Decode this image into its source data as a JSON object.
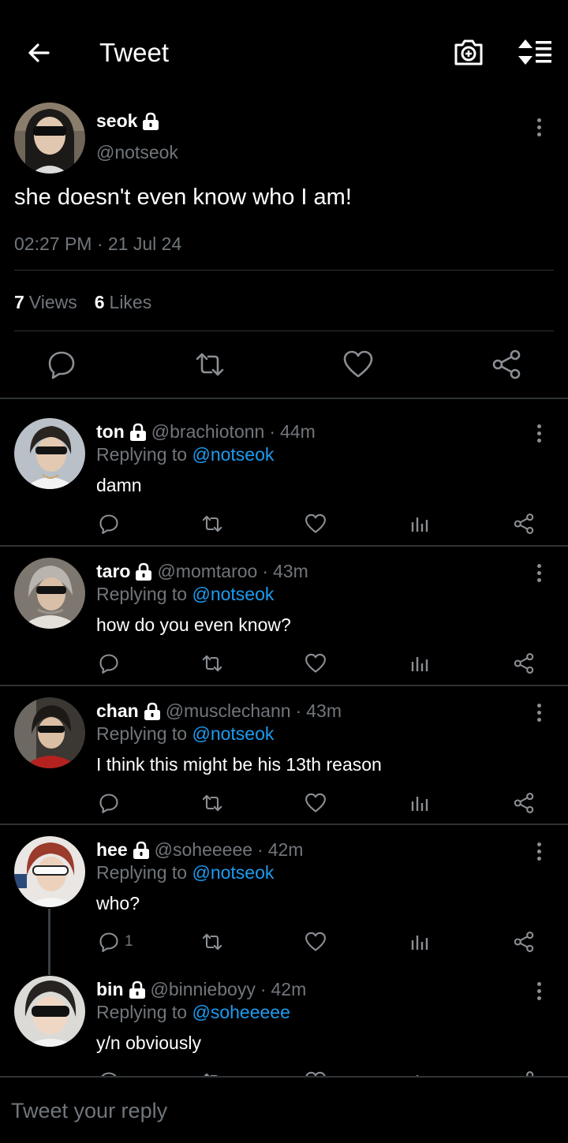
{
  "header": {
    "title": "Tweet",
    "back_icon": "arrow-left-icon",
    "camera_icon": "camera-plus-icon",
    "sort_icon": "sort-list-icon"
  },
  "main_tweet": {
    "name": "seok",
    "handle": "@notseok",
    "text": "she doesn't even know who I am!",
    "timestamp": "02:27 PM · 21 Jul 24",
    "views_count": "7",
    "views_label": "Views",
    "likes_count": "6",
    "likes_label": "Likes"
  },
  "replies": [
    {
      "name": "ton",
      "handle": "@brachiotonn",
      "ago": "44m",
      "replying_prefix": "Replying to",
      "replying_to": "@notseok",
      "text": "damn",
      "reply_count": ""
    },
    {
      "name": "taro",
      "handle": "@momtaroo",
      "ago": "43m",
      "replying_prefix": "Replying to",
      "replying_to": "@notseok",
      "text": "how do you even know?",
      "reply_count": ""
    },
    {
      "name": "chan",
      "handle": "@musclechann",
      "ago": "43m",
      "replying_prefix": "Replying to",
      "replying_to": "@notseok",
      "text": "I think this might be his 13th reason",
      "reply_count": ""
    },
    {
      "name": "hee",
      "handle": "@soheeeee",
      "ago": "42m",
      "replying_prefix": "Replying to",
      "replying_to": "@notseok",
      "text": "who?",
      "reply_count": "1"
    },
    {
      "name": "bin",
      "handle": "@binnieboyy",
      "ago": "42m",
      "replying_prefix": "Replying to",
      "replying_to": "@soheeeee",
      "text": "y/n obviously",
      "reply_count": ""
    }
  ],
  "separator": "·",
  "compose": {
    "placeholder": "Tweet your reply"
  },
  "colors": {
    "background": "#000000",
    "accent": "#1d9bf0",
    "muted": "#71767b",
    "divider": "#2f3336"
  }
}
